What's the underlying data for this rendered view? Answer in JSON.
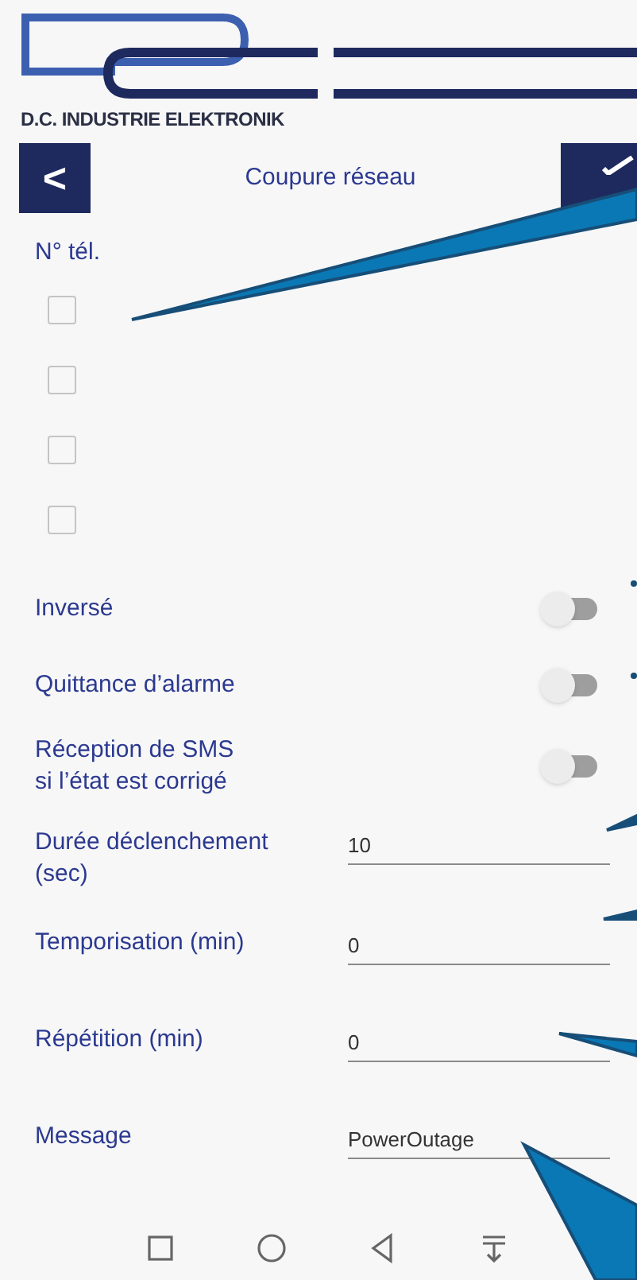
{
  "brand": {
    "name": "D.C. INDUSTRIE ELEKTRONIK"
  },
  "header": {
    "back": "<",
    "title": "Coupure réseau"
  },
  "phone": {
    "label": "N° tél.",
    "numbers": [
      {
        "checked": false
      },
      {
        "checked": false
      },
      {
        "checked": false
      },
      {
        "checked": false
      }
    ]
  },
  "switches": [
    {
      "label": "Inversé",
      "on": false
    },
    {
      "label": "Quittance d’alarme",
      "on": false
    },
    {
      "label": "Réception de SMS\nsi l’état est corrigé",
      "on": false
    }
  ],
  "fields": [
    {
      "label": "Durée déclenchement\n(sec)",
      "value": "10"
    },
    {
      "label": "Temporisation (min)",
      "value": "0"
    },
    {
      "label": "Répétition (min)",
      "value": "0"
    },
    {
      "label": "Message",
      "value": "PowerOutage"
    }
  ]
}
